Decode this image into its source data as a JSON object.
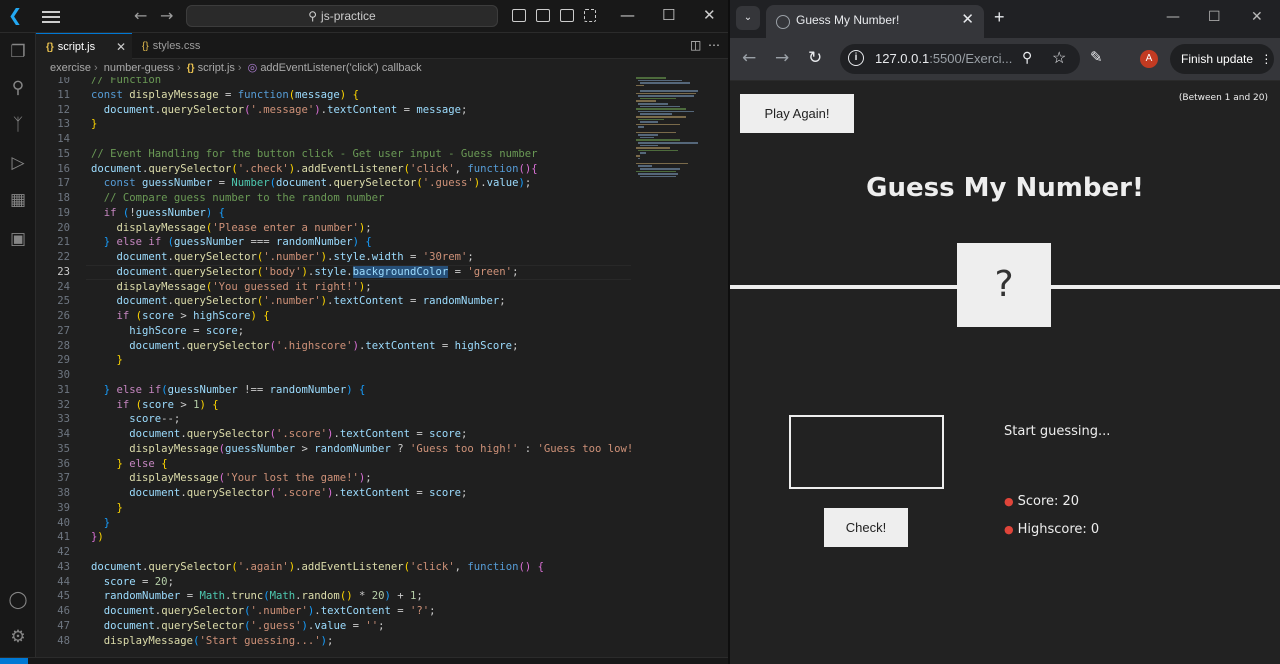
{
  "vscode": {
    "search": "js-practice",
    "tabs": [
      {
        "label": "script.js",
        "icon": "{}",
        "active": true
      },
      {
        "label": "styles.css",
        "icon": "{}",
        "active": false
      }
    ],
    "breadcrumb": [
      "exercise",
      "number-guess",
      "script.js",
      "addEventListener('click') callback"
    ],
    "code_lines": [
      {
        "n": "10",
        "html": "<span class='cmt'>// Function</span>"
      },
      {
        "n": "11",
        "html": "<span class='kw'>const</span> <span class='fn'>displayMessage</span> = <span class='kw'>function</span><span class='br1'>(</span><span class='var'>message</span><span class='br1'>)</span> <span class='br1'>{</span>"
      },
      {
        "n": "12",
        "html": "  <span class='var'>document</span>.<span class='fn'>querySelector</span><span class='br2'>(</span><span class='str'>'.message'</span><span class='br2'>)</span>.<span class='var'>textContent</span> = <span class='var'>message</span>;"
      },
      {
        "n": "13",
        "html": "<span class='br1'>}</span>"
      },
      {
        "n": "14",
        "html": ""
      },
      {
        "n": "15",
        "html": "<span class='cmt'>// Event Handling for the button click - Get user input - Guess number</span>"
      },
      {
        "n": "16",
        "html": "<span class='var'>document</span>.<span class='fn'>querySelector</span><span class='br1'>(</span><span class='str'>'.check'</span><span class='br1'>)</span>.<span class='fn'>addEventListener</span><span class='br1'>(</span><span class='str'>'click'</span>, <span class='kw'>function</span><span class='br2'>()</span><span class='br2'>{</span>"
      },
      {
        "n": "17",
        "html": "  <span class='kw'>const</span> <span class='var'>guessNumber</span> = <span class='cls'>Number</span><span class='br3'>(</span><span class='var'>document</span>.<span class='fn'>querySelector</span><span class='br1'>(</span><span class='str'>'.guess'</span><span class='br1'>)</span>.<span class='var'>value</span><span class='br3'>)</span>;"
      },
      {
        "n": "18",
        "html": "  <span class='cmt'>// Compare guess number to the random number</span>"
      },
      {
        "n": "19",
        "html": "  <span class='ctl'>if</span> <span class='br3'>(</span>!<span class='var'>guessNumber</span><span class='br3'>)</span> <span class='br3'>{</span>"
      },
      {
        "n": "20",
        "html": "    <span class='fn'>displayMessage</span><span class='br1'>(</span><span class='str'>'Please enter a number'</span><span class='br1'>)</span>;"
      },
      {
        "n": "21",
        "html": "  <span class='br3'>}</span> <span class='ctl'>else if</span> <span class='br3'>(</span><span class='var'>guessNumber</span> === <span class='var'>randomNumber</span><span class='br3'>)</span> <span class='br3'>{</span>"
      },
      {
        "n": "22",
        "html": "    <span class='var'>document</span>.<span class='fn'>querySelector</span><span class='br1'>(</span><span class='str'>'.number'</span><span class='br1'>)</span>.<span class='var'>style</span>.<span class='var'>width</span> = <span class='str'>'30rem'</span>;"
      },
      {
        "n": "23",
        "html": "    <span class='var'>document</span>.<span class='fn'>querySelector</span><span class='br1'>(</span><span class='str'>'body'</span><span class='br1'>)</span>.<span class='var'>style</span>.<span class='var sel'>backgroundColor</span> = <span class='str'>'green'</span>;",
        "current": true
      },
      {
        "n": "24",
        "html": "    <span class='fn'>displayMessage</span><span class='br1'>(</span><span class='str'>'You guessed it right!'</span><span class='br1'>)</span>;"
      },
      {
        "n": "25",
        "html": "    <span class='var'>document</span>.<span class='fn'>querySelector</span><span class='br1'>(</span><span class='str'>'.number'</span><span class='br1'>)</span>.<span class='var'>textContent</span> = <span class='var'>randomNumber</span>;"
      },
      {
        "n": "26",
        "html": "    <span class='ctl'>if</span> <span class='br1'>(</span><span class='var'>score</span> &gt; <span class='var'>highScore</span><span class='br1'>)</span> <span class='br1'>{</span>"
      },
      {
        "n": "27",
        "html": "      <span class='var'>highScore</span> = <span class='var'>score</span>;"
      },
      {
        "n": "28",
        "html": "      <span class='var'>document</span>.<span class='fn'>querySelector</span><span class='br2'>(</span><span class='str'>'.highscore'</span><span class='br2'>)</span>.<span class='var'>textContent</span> = <span class='var'>highScore</span>;"
      },
      {
        "n": "29",
        "html": "    <span class='br1'>}</span>"
      },
      {
        "n": "30",
        "html": ""
      },
      {
        "n": "31",
        "html": "  <span class='br3'>}</span> <span class='ctl'>else if</span><span class='br3'>(</span><span class='var'>guessNumber</span> !== <span class='var'>randomNumber</span><span class='br3'>)</span> <span class='br3'>{</span>"
      },
      {
        "n": "32",
        "html": "    <span class='ctl'>if</span> <span class='br1'>(</span><span class='var'>score</span> &gt; <span class='num'>1</span><span class='br1'>)</span> <span class='br1'>{</span>"
      },
      {
        "n": "33",
        "html": "      <span class='var'>score</span>--;"
      },
      {
        "n": "34",
        "html": "      <span class='var'>document</span>.<span class='fn'>querySelector</span><span class='br2'>(</span><span class='str'>'.score'</span><span class='br2'>)</span>.<span class='var'>textContent</span> = <span class='var'>score</span>;"
      },
      {
        "n": "35",
        "html": "      <span class='fn'>displayMessage</span><span class='br2'>(</span><span class='var'>guessNumber</span> &gt; <span class='var'>randomNumber</span> ? <span class='str'>'Guess too high!'</span> : <span class='str'>'Guess too low!'</span><span class='br2'>)</span>;"
      },
      {
        "n": "36",
        "html": "    <span class='br1'>}</span> <span class='ctl'>else</span> <span class='br1'>{</span>"
      },
      {
        "n": "37",
        "html": "      <span class='fn'>displayMessage</span><span class='br2'>(</span><span class='str'>'Your lost the game!'</span><span class='br2'>)</span>;"
      },
      {
        "n": "38",
        "html": "      <span class='var'>document</span>.<span class='fn'>querySelector</span><span class='br2'>(</span><span class='str'>'.score'</span><span class='br2'>)</span>.<span class='var'>textContent</span> = <span class='var'>score</span>;"
      },
      {
        "n": "39",
        "html": "    <span class='br1'>}</span>"
      },
      {
        "n": "40",
        "html": "  <span class='br3'>}</span>"
      },
      {
        "n": "41",
        "html": "<span class='br2'>}</span><span class='br1'>)</span>"
      },
      {
        "n": "42",
        "html": ""
      },
      {
        "n": "43",
        "html": "<span class='var'>document</span>.<span class='fn'>querySelector</span><span class='br1'>(</span><span class='str'>'.again'</span><span class='br1'>)</span>.<span class='fn'>addEventListener</span><span class='br1'>(</span><span class='str'>'click'</span>, <span class='kw'>function</span><span class='br2'>()</span> <span class='br2'>{</span>"
      },
      {
        "n": "44",
        "html": "  <span class='var'>score</span> = <span class='num'>20</span>;"
      },
      {
        "n": "45",
        "html": "  <span class='var'>randomNumber</span> = <span class='cls'>Math</span>.<span class='fn'>trunc</span><span class='br3'>(</span><span class='cls'>Math</span>.<span class='fn'>random</span><span class='br1'>()</span> * <span class='num'>20</span><span class='br3'>)</span> + <span class='num'>1</span>;"
      },
      {
        "n": "46",
        "html": "  <span class='var'>document</span>.<span class='fn'>querySelector</span><span class='br3'>(</span><span class='str'>'.number'</span><span class='br3'>)</span>.<span class='var'>textContent</span> = <span class='str'>'?'</span>;"
      },
      {
        "n": "47",
        "html": "  <span class='var'>document</span>.<span class='fn'>querySelector</span><span class='br3'>(</span><span class='str'>'.guess'</span><span class='br3'>)</span>.<span class='var'>value</span> = <span class='str'>''</span>;"
      },
      {
        "n": "48",
        "html": "  <span class='fn'>displayMessage</span><span class='br3'>(</span><span class='str'>'Start guessing...'</span><span class='br3'>)</span>;"
      }
    ]
  },
  "browser": {
    "tab_title": "Guess My Number!",
    "url_host": "127.0.0.1",
    "url_rest": ":5500/Exerci...",
    "avatar": "A",
    "finish_update": "Finish update"
  },
  "game": {
    "again_label": "Play Again!",
    "between": "(Between 1 and 20)",
    "title": "Guess My Number!",
    "number": "?",
    "check_label": "Check!",
    "message": "Start guessing...",
    "score_label": "Score: 20",
    "highscore_label": "Highscore: 0"
  }
}
